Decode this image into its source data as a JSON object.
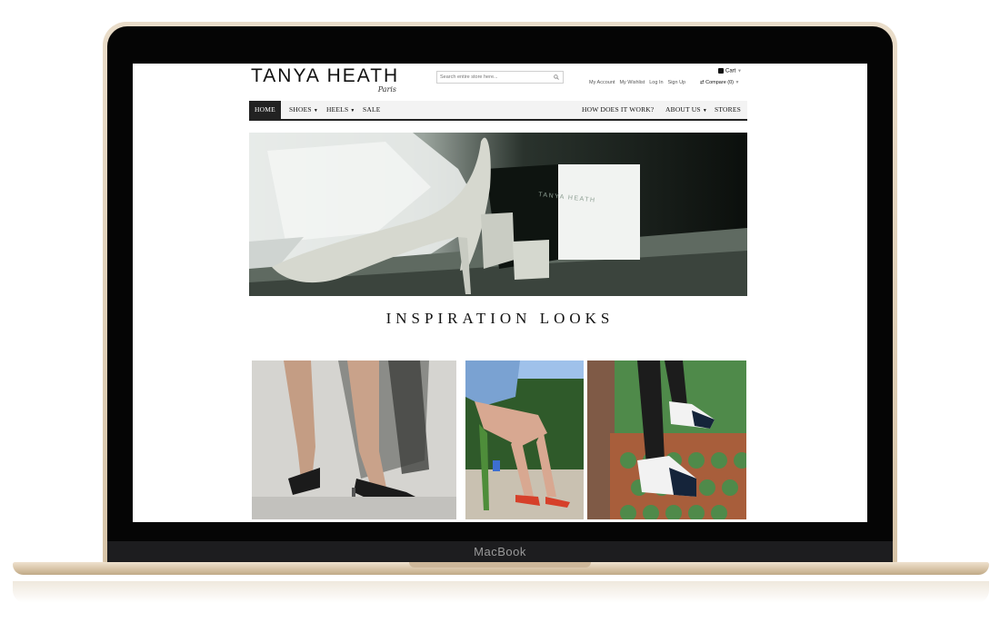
{
  "device": {
    "label": "MacBook"
  },
  "site": {
    "logo_main": "TANYA HEATH",
    "logo_sub": "Paris",
    "search_placeholder": "Search entire store here...",
    "cart_label": "Cart",
    "account_links": [
      "My Account",
      "My Wishlist",
      "Log In",
      "Sign Up"
    ],
    "compare_label": "Compare (0)"
  },
  "nav": {
    "home": "HOME",
    "shoes": "SHOES",
    "heels": "HEELS",
    "sale": "SALE",
    "how": "HOW DOES IT WORK?",
    "about": "ABOUT US",
    "stores": "STORES"
  },
  "hero": {
    "box_text": "TANYA HEATH"
  },
  "section": {
    "title": "INSPIRATION LOOKS"
  },
  "icons": [
    "search-icon",
    "shopping-bag-icon",
    "compare-arrows-icon",
    "caret-down-icon"
  ]
}
